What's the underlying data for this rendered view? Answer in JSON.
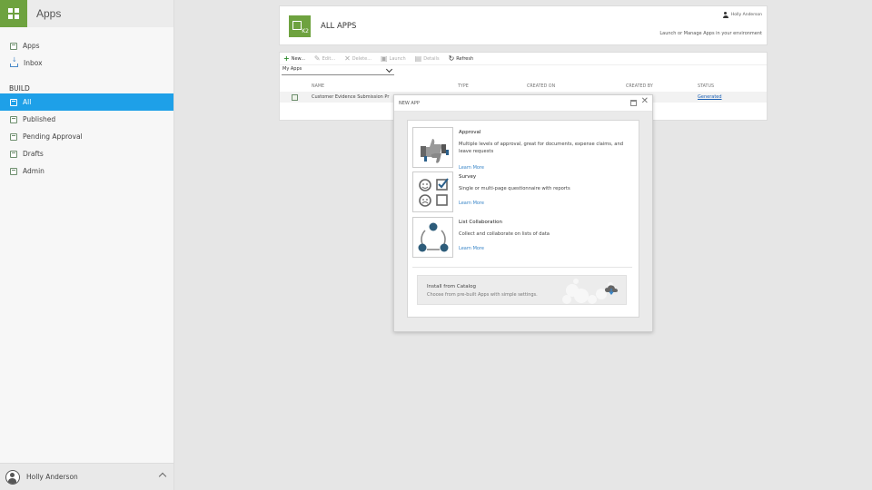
{
  "sidebar": {
    "title": "Apps",
    "nav": [
      {
        "label": "Apps"
      },
      {
        "label": "Inbox"
      }
    ],
    "section_label": "BUILD",
    "build_items": [
      {
        "label": "All",
        "active": true
      },
      {
        "label": "Published"
      },
      {
        "label": "Pending Approval"
      },
      {
        "label": "Drafts"
      },
      {
        "label": "Admin"
      }
    ],
    "user_name": "Holly Anderson"
  },
  "header": {
    "title": "ALL APPS",
    "user": "Holly Anderson",
    "subtitle": "Launch or Manage Apps in your environment"
  },
  "toolbar": {
    "new": "New...",
    "edit": "Edit...",
    "delete": "Delete...",
    "launch": "Launch",
    "details": "Details",
    "refresh": "Refresh"
  },
  "filter": {
    "selected": "My Apps"
  },
  "table": {
    "columns": [
      "NAME",
      "TYPE",
      "CREATED ON",
      "CREATED BY",
      "STATUS"
    ],
    "rows": [
      {
        "name": "Customer Evidence Submission Pr",
        "status": "Generated"
      }
    ]
  },
  "modal": {
    "title": "NEW APP",
    "options": [
      {
        "name": "Approval",
        "description": "Multiple levels of approval, great for documents, expense claims, and leave requests",
        "learn": "Learn More"
      },
      {
        "name": "Survey",
        "description": "Single or multi-page questionnaire with reports",
        "learn": "Learn More"
      },
      {
        "name": "List Collaboration",
        "description": "Collect and collaborate on lists of data",
        "learn": "Learn More"
      }
    ],
    "catalog": {
      "title": "Install from Catalog",
      "description": "Choose from pre-built Apps with simple settings."
    }
  },
  "colors": {
    "accent_green": "#6ea23f",
    "active_blue": "#1ea0e8",
    "link_blue": "#3a86c8"
  }
}
